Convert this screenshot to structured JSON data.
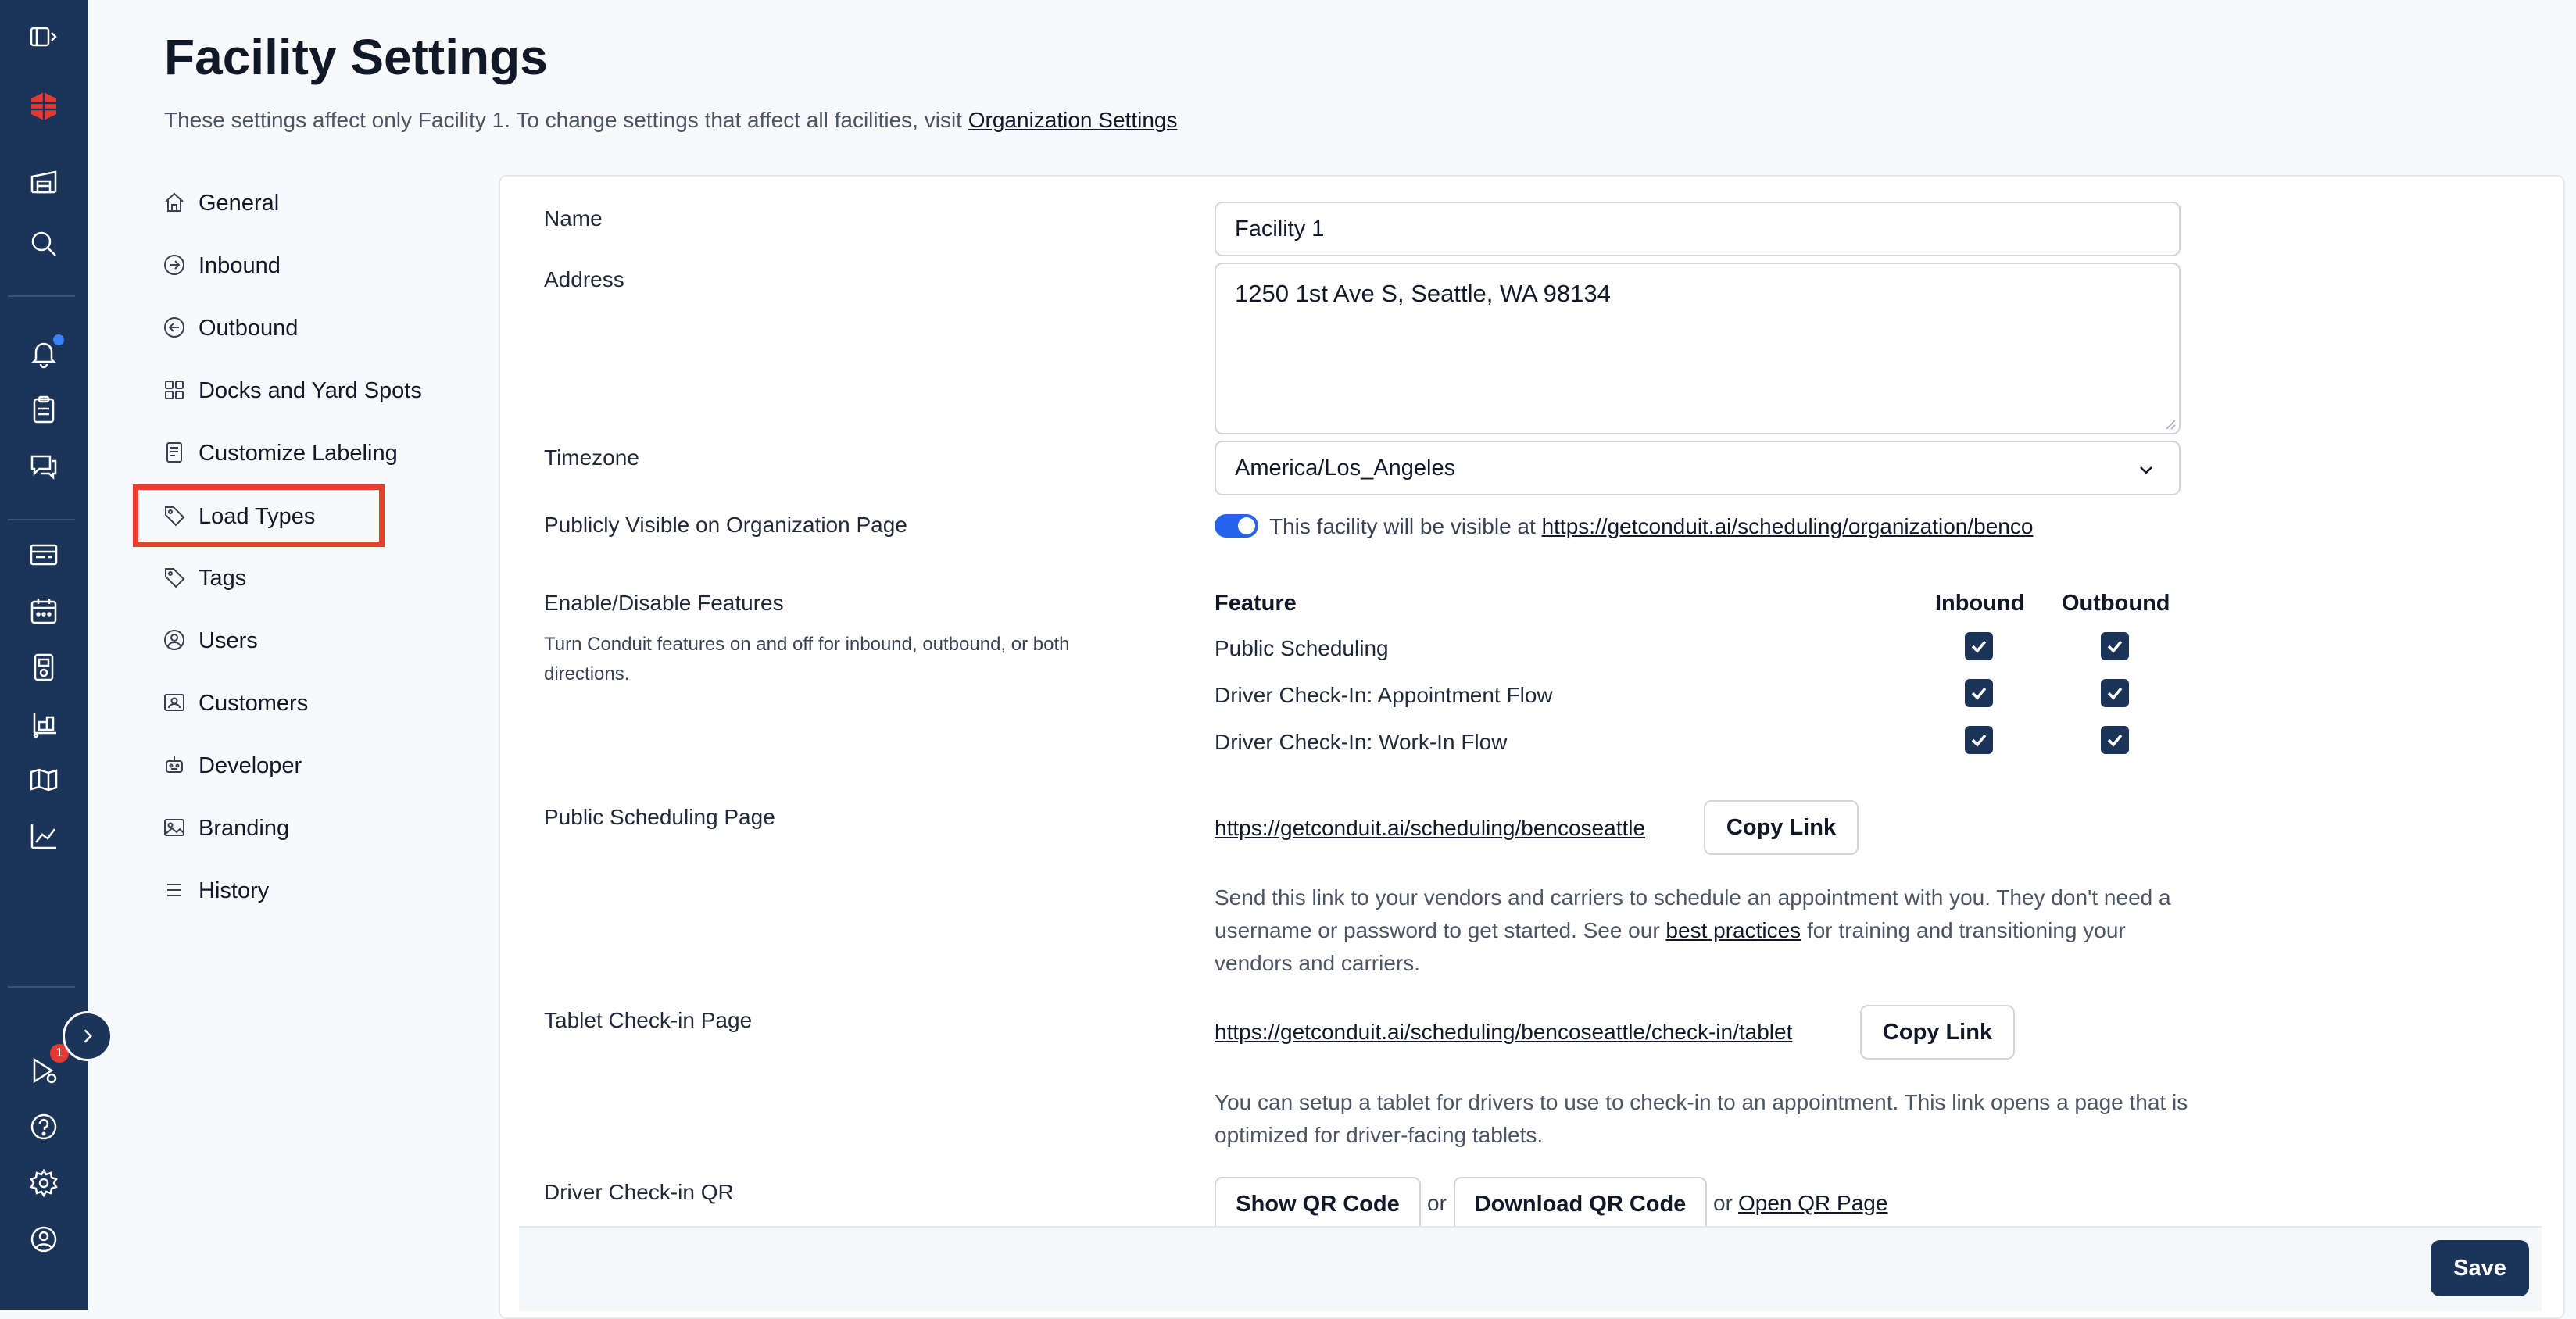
{
  "rail": {
    "items": [
      "sidebar-toggle-icon",
      "brand-logo",
      "facility-icon",
      "search-icon",
      "bell-icon",
      "clipboard-icon",
      "chat-icon",
      "appointments-icon",
      "calendar-icon",
      "dock-icon",
      "load-icon",
      "map-icon",
      "chart-icon",
      "video-icon",
      "help-icon",
      "gear-icon",
      "user-circle-icon"
    ],
    "notification_badge": "1"
  },
  "header": {
    "title": "Facility Settings",
    "subtitle": "These settings affect only Facility 1. To change settings that affect all facilities, visit",
    "subtitle_link": "Organization Settings"
  },
  "nav": [
    {
      "label": "General",
      "icon": "home-icon"
    },
    {
      "label": "Inbound",
      "icon": "arrow-right-circle-icon"
    },
    {
      "label": "Outbound",
      "icon": "arrow-left-circle-icon"
    },
    {
      "label": "Docks and Yard Spots",
      "icon": "grid-icon"
    },
    {
      "label": "Customize Labeling",
      "icon": "label-doc-icon"
    },
    {
      "label": "Load Types",
      "icon": "tag-icon"
    },
    {
      "label": "Tags",
      "icon": "tag-icon"
    },
    {
      "label": "Users",
      "icon": "user-circle-icon"
    },
    {
      "label": "Customers",
      "icon": "contact-card-icon"
    },
    {
      "label": "Developer",
      "icon": "robot-icon"
    },
    {
      "label": "Branding",
      "icon": "image-icon"
    },
    {
      "label": "History",
      "icon": "list-icon"
    }
  ],
  "form": {
    "name_label": "Name",
    "name_value": "Facility 1",
    "address_label": "Address",
    "address_value": "1250 1st Ave S, Seattle, WA 98134",
    "timezone_label": "Timezone",
    "timezone_value": "America/Los_Angeles",
    "visible_label": "Publicly Visible on Organization Page",
    "visible_text": "This facility will be visible at",
    "visible_link": "https://getconduit.ai/scheduling/organization/benco",
    "visible_on": true,
    "features_label": "Enable/Disable Features",
    "features_hint": "Turn Conduit features on and off for inbound, outbound, or both directions.",
    "features_header": {
      "feature": "Feature",
      "inbound": "Inbound",
      "outbound": "Outbound"
    },
    "features": [
      {
        "name": "Public Scheduling",
        "inbound": true,
        "outbound": true
      },
      {
        "name": "Driver Check-In: Appointment Flow",
        "inbound": true,
        "outbound": true
      },
      {
        "name": "Driver Check-In: Work-In Flow",
        "inbound": true,
        "outbound": true
      }
    ],
    "public_label": "Public Scheduling Page",
    "public_link": "https://getconduit.ai/scheduling/bencoseattle",
    "copy_label": "Copy Link",
    "public_desc_1": "Send this link to your vendors and carriers to schedule an appointment with you. They don't need a username or password to get started. See our",
    "public_desc_link": "best practices",
    "public_desc_2": "for training and transitioning your vendors and carriers.",
    "tablet_label": "Tablet Check-in Page",
    "tablet_link": "https://getconduit.ai/scheduling/bencoseattle/check-in/tablet",
    "tablet_desc": "You can setup a tablet for drivers to use to check-in to an appointment. This link opens a page that is optimized for driver-facing tablets.",
    "qr_label": "Driver Check-in QR",
    "show_qr": "Show QR Code",
    "or_text": "or",
    "download_qr": "Download QR Code",
    "open_qr": "Open QR Page"
  },
  "footer": {
    "save": "Save"
  },
  "colors": {
    "rail": "#1c3458",
    "highlight": "#e5412c",
    "toggle": "#2563eb",
    "brand": "#e53935"
  }
}
